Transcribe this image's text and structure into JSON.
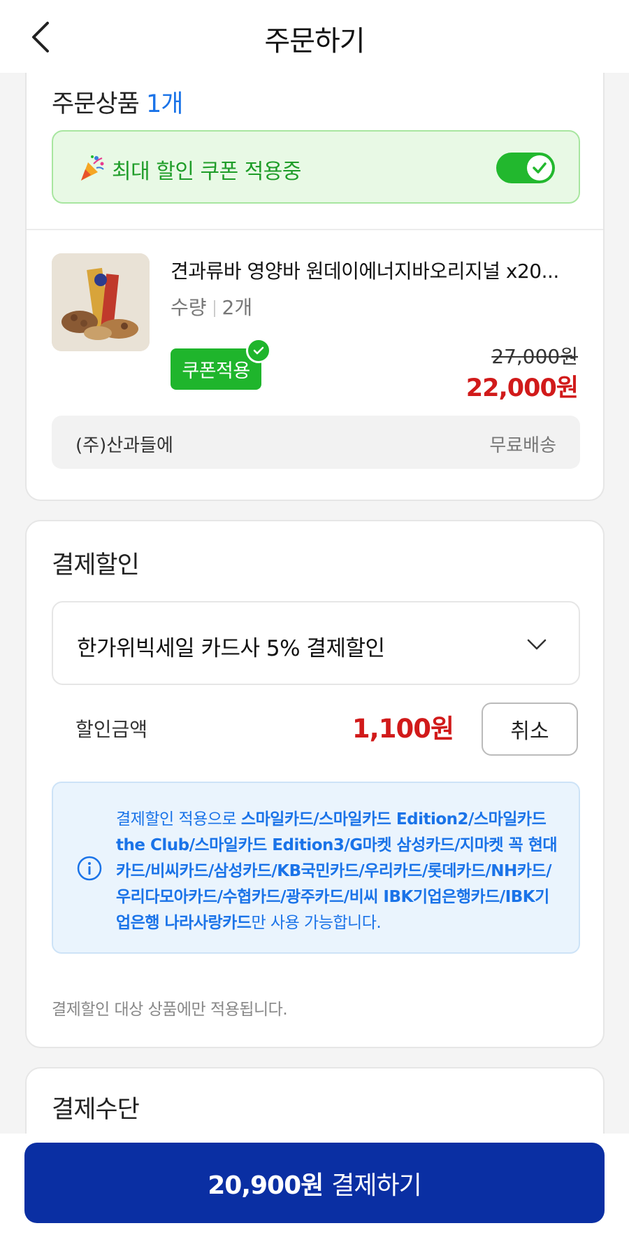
{
  "header": {
    "title": "주문하기",
    "back_icon": "chevron-left-icon"
  },
  "order": {
    "title": "주문상품",
    "count": "1개",
    "coupon_banner": {
      "text": "최대 할인 쿠폰 적용중",
      "toggle_on": true,
      "icon": "party-popper-icon"
    },
    "product": {
      "name": "견과류바 영양바 원데이에너지바오리지널 x20...",
      "qty_label": "수량",
      "qty_value": "2개",
      "coupon_badge": "쿠폰적용",
      "original_price": "27,000원",
      "sale_price": "22,000원"
    },
    "seller": {
      "name": "(주)산과들에",
      "shipping": "무료배송"
    }
  },
  "payment_discount": {
    "title": "결제할인",
    "selected": "한가위빅세일 카드사 5% 결제할인",
    "amount_label": "할인금액",
    "amount": "1,100원",
    "cancel_label": "취소",
    "info": {
      "prefix": "결제할인 적용으로 ",
      "cards": "스마일카드/스마일카드 Edition2/스마일카드 the Club/스마일카드 Edition3/G마켓 삼성카드/지마켓 꼭 현대카드/비씨카드/삼성카드/KB국민카드/우리카드/롯데카드/NH카드/우리다모아카드/수협카드/광주카드/비씨 IBK기업은행카드/IBK기업은행 나라사랑카드",
      "suffix": "만 사용 가능합니다."
    },
    "note": "결제할인 대상 상품에만 적용됩니다."
  },
  "payment_method": {
    "title": "결제수단"
  },
  "pay_button": {
    "amount": "20,900원",
    "label": "결제하기"
  },
  "colors": {
    "accent_blue": "#1a73e8",
    "pay_blue": "#0a2fa3",
    "green": "#1fb52c",
    "red": "#d11a1a"
  }
}
